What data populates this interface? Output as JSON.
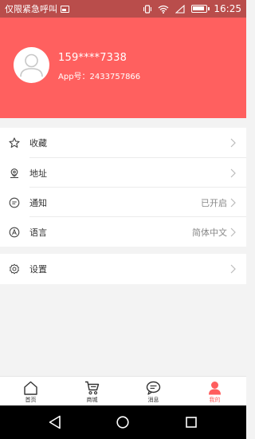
{
  "status_bar": {
    "left_text": "仅限紧急呼叫",
    "time": "16:25"
  },
  "profile": {
    "phone": "159****7338",
    "app_id": "App号：2433757866",
    "avatar_icon": "user-avatar-icon"
  },
  "menu_group1": [
    {
      "icon": "star-icon",
      "label": "收藏",
      "value": ""
    },
    {
      "icon": "location-icon",
      "label": "地址",
      "value": ""
    },
    {
      "icon": "message-icon",
      "label": "通知",
      "value": "已开启"
    },
    {
      "icon": "language-icon",
      "label": "语言",
      "value": "简体中文"
    }
  ],
  "menu_group2": [
    {
      "icon": "gear-icon",
      "label": "设置",
      "value": ""
    }
  ],
  "tabbar": {
    "tabs": [
      {
        "icon": "home-icon",
        "label": "首页",
        "active": false
      },
      {
        "icon": "cart-icon",
        "label": "商城",
        "active": false
      },
      {
        "icon": "chat-icon",
        "label": "消息",
        "active": false
      },
      {
        "icon": "profile-icon",
        "label": "我的",
        "active": true
      }
    ]
  },
  "colors": {
    "accent": "#ff605f",
    "status_bar": "#b94d4b",
    "active_tab": "#ff5e5e"
  }
}
